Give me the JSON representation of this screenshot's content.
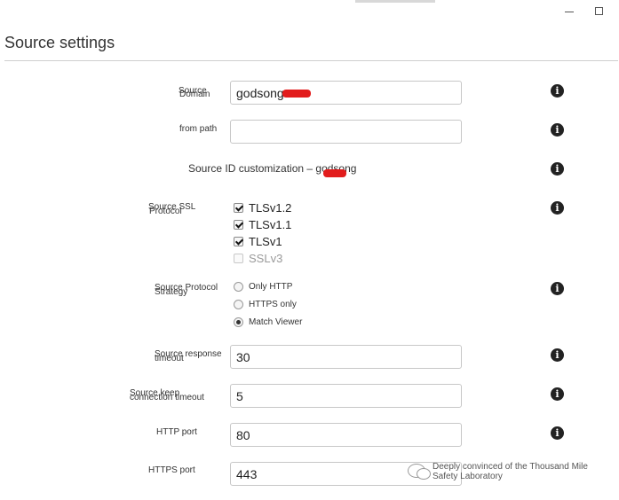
{
  "window": {
    "minimize_glyph": "",
    "maximize_glyph": ""
  },
  "page": {
    "title": "Source settings"
  },
  "fields": {
    "source_domain": {
      "label_line1": "Source",
      "label_line2": "Domain",
      "value": "godsong"
    },
    "from_path": {
      "label": "from path",
      "value": ""
    },
    "source_id": {
      "text": "Source ID customization – godsong"
    },
    "ssl_protocol": {
      "label_line1": "Source SSL",
      "label_line2": "Protocol",
      "options": [
        {
          "label": "TLSv1.2",
          "checked": true,
          "disabled": false
        },
        {
          "label": "TLSv1.1",
          "checked": true,
          "disabled": false
        },
        {
          "label": "TLSv1",
          "checked": true,
          "disabled": false
        },
        {
          "label": "SSLv3",
          "checked": false,
          "disabled": true
        }
      ]
    },
    "protocol_strategy": {
      "label_line1": "Source Protocol",
      "label_line2": "Strategy",
      "options": [
        {
          "label": "Only HTTP",
          "selected": false
        },
        {
          "label": "HTTPS only",
          "selected": false
        },
        {
          "label": "Match Viewer",
          "selected": true
        }
      ]
    },
    "response_timeout": {
      "label_line1": "Source response",
      "label_line2": "timeout",
      "value": "30"
    },
    "keepalive_timeout": {
      "label_line1": "Source keep",
      "label_line2": "connection timeout",
      "value": "5"
    },
    "http_port": {
      "label": "HTTP port",
      "value": "80"
    },
    "https_port": {
      "label": "HTTPS port",
      "value": "443"
    }
  },
  "info_icon": {
    "glyph": "i",
    "name": "info-icon"
  },
  "watermark": {
    "line1": "Deeply convinced of the Thousand Mile",
    "line2": "Safety Laboratory"
  },
  "colors": {
    "redaction": "#e21c1c",
    "input_border": "#c7c7c7",
    "icon": "#222222"
  }
}
